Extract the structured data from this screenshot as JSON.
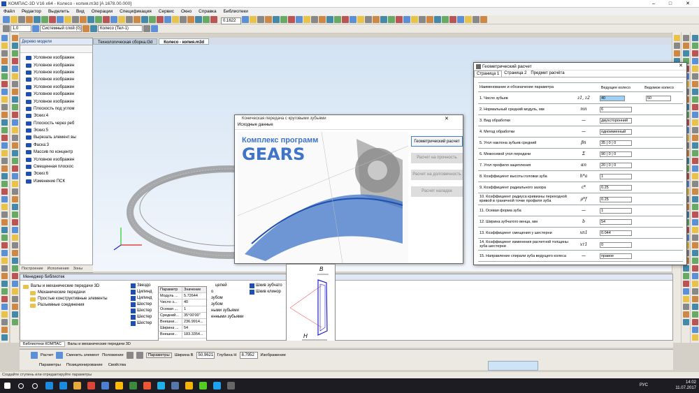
{
  "window": {
    "title": "КОМПАС-3D V16  x64 - Колесо - копия.m3d [A 1678.00.000]",
    "min": "–",
    "max": "□",
    "close": "✕"
  },
  "menu": [
    "Файл",
    "Редактор",
    "Выделить",
    "Вид",
    "Операции",
    "Спецификация",
    "Сервис",
    "Окно",
    "Справка",
    "Библиотеки"
  ],
  "toolbar": {
    "scale": "1.0",
    "style": "Системный слой (0)",
    "part": "Колесо (Тел-1)",
    "zoom": "0.1622"
  },
  "model_tree": {
    "title": "Дерево модели",
    "items": [
      "Условное изображен",
      "Условное изображен",
      "Условное изображен",
      "Условное изображен",
      "Условное изображен",
      "Условное изображен",
      "Условное изображен",
      "Плоскость под углом",
      "Эскиз:4",
      "Плоскость через реб",
      "Эскиз:5",
      "Вырезать элемент вы",
      "Фаска:3",
      "Массив по концентр",
      "Условное изображен",
      "Смещенная плоскос",
      "Эскиз:6",
      "Изменение ПСК"
    ],
    "tabs": [
      "Построение",
      "Исполнения",
      "Зоны"
    ]
  },
  "doc_tabs": [
    "Технологическая сборка.t3d",
    "Колесо - копия.m3d"
  ],
  "gears_dialog": {
    "title": "Коническая передача с круговыми зубьями",
    "menu": "Исходные данные",
    "logo_line1": "Комплекс программ",
    "logo_line2": "GEARS",
    "buttons": [
      "Геометрический расчет",
      "Расчет на прочность",
      "Расчет на долговечность",
      "Расчет наладок"
    ]
  },
  "geo": {
    "title": "Геометрический расчет",
    "tabs": [
      "Страница 1",
      "Страница 2",
      "Предмет расчёта"
    ],
    "headers": [
      "Наименование и обозначение параметра",
      "Ведущее колесо",
      "Ведомое колесо"
    ],
    "rows": [
      {
        "name": "1. Число зубьев",
        "sym": "z1, z2",
        "v1": "40",
        "v2": "50"
      },
      {
        "name": "2. Нормальный средний модуль, мм",
        "sym": "mn",
        "v1": "6",
        "v2": ""
      },
      {
        "name": "3. Вид обработки",
        "sym": "—",
        "v1": "двухсторонний",
        "v2": ""
      },
      {
        "name": "4. Метод обработки",
        "sym": "—",
        "v1": "одноименный",
        "v2": ""
      },
      {
        "name": "5. Угол наклона зубьев средний",
        "sym": "βn",
        "v1": "35 | 0 | 0",
        "v2": ""
      },
      {
        "name": "6. Межосевой угол передачи",
        "sym": "Σ",
        "v1": "90 | 0 | 0",
        "v2": ""
      },
      {
        "name": "7. Угол профиля зацепления",
        "sym": "αn",
        "v1": "20 | 0 | 0",
        "v2": ""
      },
      {
        "name": "8. Коэффициент высоты головки зуба",
        "sym": "h*a",
        "v1": "1",
        "v2": ""
      },
      {
        "name": "9. Коэффициент радиального зазора",
        "sym": "c*",
        "v1": "0.25",
        "v2": ""
      },
      {
        "name": "10. Коэффициент радиуса кривизны переходной кривой в граничной точке профиля зуба",
        "sym": "ρ*f",
        "v1": "0.25",
        "v2": ""
      },
      {
        "name": "11. Осевая форма зуба",
        "sym": "—",
        "v1": "1",
        "v2": ""
      },
      {
        "name": "12. Ширина зубчатого венца, мм",
        "sym": "b",
        "v1": "54",
        "v2": ""
      },
      {
        "name": "13. Коэффициент смещения у шестерни",
        "sym": "xn1",
        "v1": "0.044",
        "v2": ""
      },
      {
        "name": "14. Коэффициент изменения расчетной толщины зуба шестерни",
        "sym": "xτ1",
        "v1": "0",
        "v2": ""
      },
      {
        "name": "15. Направление спирали зуба ведущего колеса",
        "sym": "—",
        "v1": "правое",
        "v2": ""
      }
    ]
  },
  "library": {
    "title": "Менеджер библиотек",
    "root": "Валы и механические передачи 3D",
    "folders": [
      "Механические передачи",
      "Простые конструктивные элементы",
      "Разъемные соединения"
    ],
    "list1": [
      "Звездо",
      "Цилинд",
      "Цилинд",
      "Шестер",
      "Шестер",
      "Шестер",
      "Шестер"
    ],
    "list2": [
      "цепей",
      "о",
      "зубом",
      "зубом",
      "ными зубьями",
      "енными зубьями"
    ],
    "list3": [
      "Шкив зубчато",
      "Шкив клинор"
    ],
    "tabs": [
      "Библиотеки КОМПАС",
      "Валы и механические передачи 3D"
    ]
  },
  "param_table": {
    "headers": [
      "Параметр",
      "Значение"
    ],
    "rows": [
      [
        "Модуль ...",
        "5.72644"
      ],
      [
        "Число з...",
        "40"
      ],
      [
        "Осевая ...",
        "1"
      ],
      [
        "Средний...",
        "35°00'00\""
      ],
      [
        "Внешни...",
        "236.9914..."
      ],
      [
        "Ширина ...",
        "54"
      ],
      [
        "Внешни...",
        "183.3354..."
      ]
    ]
  },
  "preview": {
    "label_b": "B",
    "label_h": "H"
  },
  "status1": {
    "params": "Параметры",
    "width_label": "Ширина В",
    "width": "50.9621",
    "depth_label": "Глубина Н",
    "depth": "8.7952",
    "image": "Изображение"
  },
  "props": {
    "calc": "Расчет",
    "replace": "Сменить элемент",
    "position": "Положение",
    "tab1": "Параметры",
    "tab2": "Позиционирование",
    "tab3": "Свойства"
  },
  "statusbar": "Создайте ступень или отредактируйте параметры",
  "clock": {
    "time": "14:02",
    "date": "11.07.2017",
    "lang": "РУС"
  },
  "colors": {
    "accent": "#1f4fb0",
    "gear_blue": "#3f74c8"
  }
}
